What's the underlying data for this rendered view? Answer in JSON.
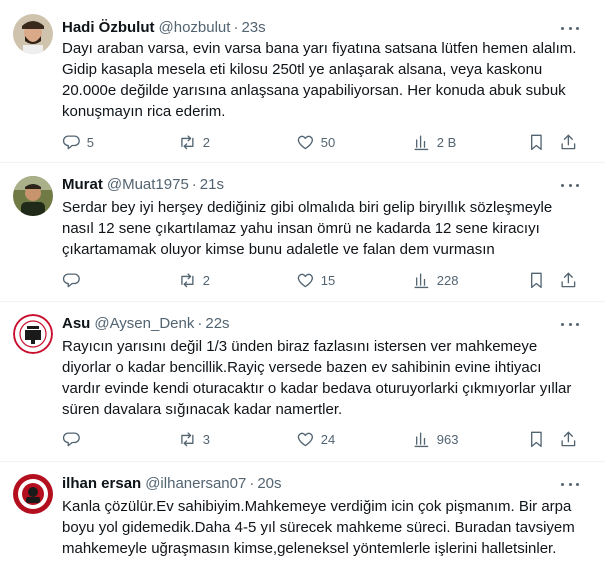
{
  "tweets": [
    {
      "name": "Hadi Özbulut",
      "handle": "@hozbulut",
      "separator": "·",
      "time": "23s",
      "text": "Dayı araban varsa, evin varsa bana yarı fiyatına satsana lütfen hemen alalım. Gidip kasapla mesela eti kilosu 250tl ye anlaşarak alsana, veya kaskonu 20.000e değilde yarısına anlaşsana yapabiliyorsan. Her konuda abuk subuk konuşmayın rica ederim.",
      "replies": "5",
      "retweets": "2",
      "likes": "50",
      "views": "2 B"
    },
    {
      "name": "Murat",
      "handle": "@Muat1975",
      "separator": "·",
      "time": "21s",
      "text": "Serdar bey iyi herşey dediğiniz gibi olmalıda biri gelip biryıllık sözleşmeyle nasıl 12 sene çıkartılamaz yahu insan ömrü ne kadarda 12 sene kiracıyı çıkartamamak oluyor kimse bunu adaletle ve falan dem vurmasın",
      "replies": "",
      "retweets": "2",
      "likes": "15",
      "views": "228"
    },
    {
      "name": "Asu",
      "handle": "@Aysen_Denk",
      "separator": "·",
      "time": "22s",
      "text": "Rayıcın yarısını değil 1/3 ünden biraz fazlasını istersen ver mahkemeye diyorlar o kadar bencillik.Rayiç versede bazen ev sahibinin evine ihtiyacı vardır evinde kendi oturacaktır  o kadar bedava oturuyorlarki çıkmıyorlar yıllar süren davalara sığınacak kadar namertler.",
      "replies": "",
      "retweets": "3",
      "likes": "24",
      "views": "963"
    },
    {
      "name": "ilhan ersan",
      "handle": "@ilhanersan07",
      "separator": "·",
      "time": "20s",
      "text": "Kanla çözülür.Ev sahibiyim.Mahkemeye verdiğim icin çok pişmanım. Bir arpa boyu yol gidemedik.Daha 4-5 yıl sürecek mahkeme süreci. Buradan tavsiyem mahkemeyle uğraşmasın kimse,geleneksel yöntemlerle işlerini halletsinler."
    }
  ],
  "icons": {
    "more": "more-horizontal-icon",
    "reply": "reply-bubble-icon",
    "retweet": "retweet-icon",
    "like": "heart-icon",
    "views": "analytics-bars-icon",
    "bookmark": "bookmark-icon",
    "share": "share-upload-icon"
  },
  "colors": {
    "text": "#0f1419",
    "secondary": "#536471",
    "divider": "#eff3f4"
  }
}
